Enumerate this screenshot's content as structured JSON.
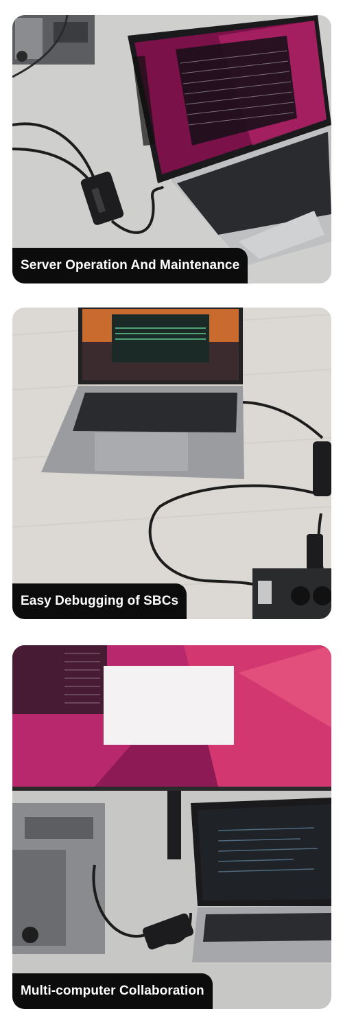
{
  "panels": [
    {
      "caption": "Server Operation And Maintenance",
      "image": "laptop-connected-to-server-photo"
    },
    {
      "caption": "Easy Debugging of SBCs",
      "image": "laptop-connected-to-single-board-computer-photo"
    },
    {
      "caption": "Multi-computer Collaboration",
      "image": "monitor-desktop-and-laptop-setup-photo"
    }
  ],
  "colors": {
    "caption_background": "#0c0c0d",
    "caption_text": "#ffffff",
    "ubuntu_magenta": "#b0206a",
    "ubuntu_orange": "#e0427a",
    "desk_grey": "#c9c9c8",
    "desk_wood": "#d9d5d0"
  }
}
